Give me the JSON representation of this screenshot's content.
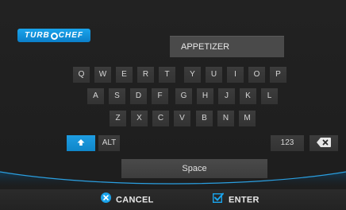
{
  "brand": {
    "logo_text_left": "TURB",
    "logo_text_right": "CHEF"
  },
  "input": {
    "value": "APPETIZER"
  },
  "keyboard": {
    "row1": [
      "Q",
      "W",
      "E",
      "R",
      "T",
      "Y",
      "U",
      "I",
      "O",
      "P"
    ],
    "row2": [
      "A",
      "S",
      "D",
      "F",
      "G",
      "H",
      "J",
      "K",
      "L"
    ],
    "row3": [
      "Z",
      "X",
      "C",
      "V",
      "B",
      "N",
      "M"
    ],
    "alt_label": "ALT",
    "numbers_label": "123",
    "space_label": "Space",
    "shift_icon": "up-arrow-icon",
    "backspace_icon": "backspace-x-icon"
  },
  "actions": {
    "cancel_label": "CANCEL",
    "enter_label": "ENTER",
    "cancel_icon": "x-circle-icon",
    "enter_icon": "checkbox-check-icon"
  },
  "colors": {
    "accent": "#1aa4ec",
    "background": "#1f1f1f",
    "key": "#383838"
  }
}
